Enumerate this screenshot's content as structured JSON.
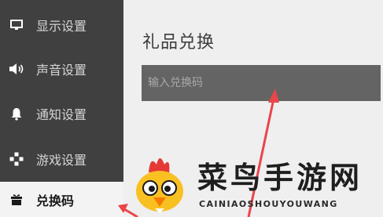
{
  "sidebar": {
    "items": [
      {
        "label": "显示设置",
        "icon": "monitor-icon"
      },
      {
        "label": "声音设置",
        "icon": "speaker-icon"
      },
      {
        "label": "通知设置",
        "icon": "bell-icon"
      },
      {
        "label": "游戏设置",
        "icon": "gamepad-icon"
      },
      {
        "label": "兑换码",
        "icon": "gift-icon",
        "active": true
      }
    ]
  },
  "main": {
    "title": "礼品兑换",
    "code_input": {
      "placeholder": "输入兑换码",
      "value": ""
    }
  },
  "watermark": {
    "text": "菜鸟手游网",
    "subtext": "CAINIAOSHOUYOUWANG"
  },
  "colors": {
    "sidebar_bg": "#404040",
    "main_bg": "#efefef",
    "input_bg": "#646464",
    "annotation_arrow": "#e8464a"
  }
}
